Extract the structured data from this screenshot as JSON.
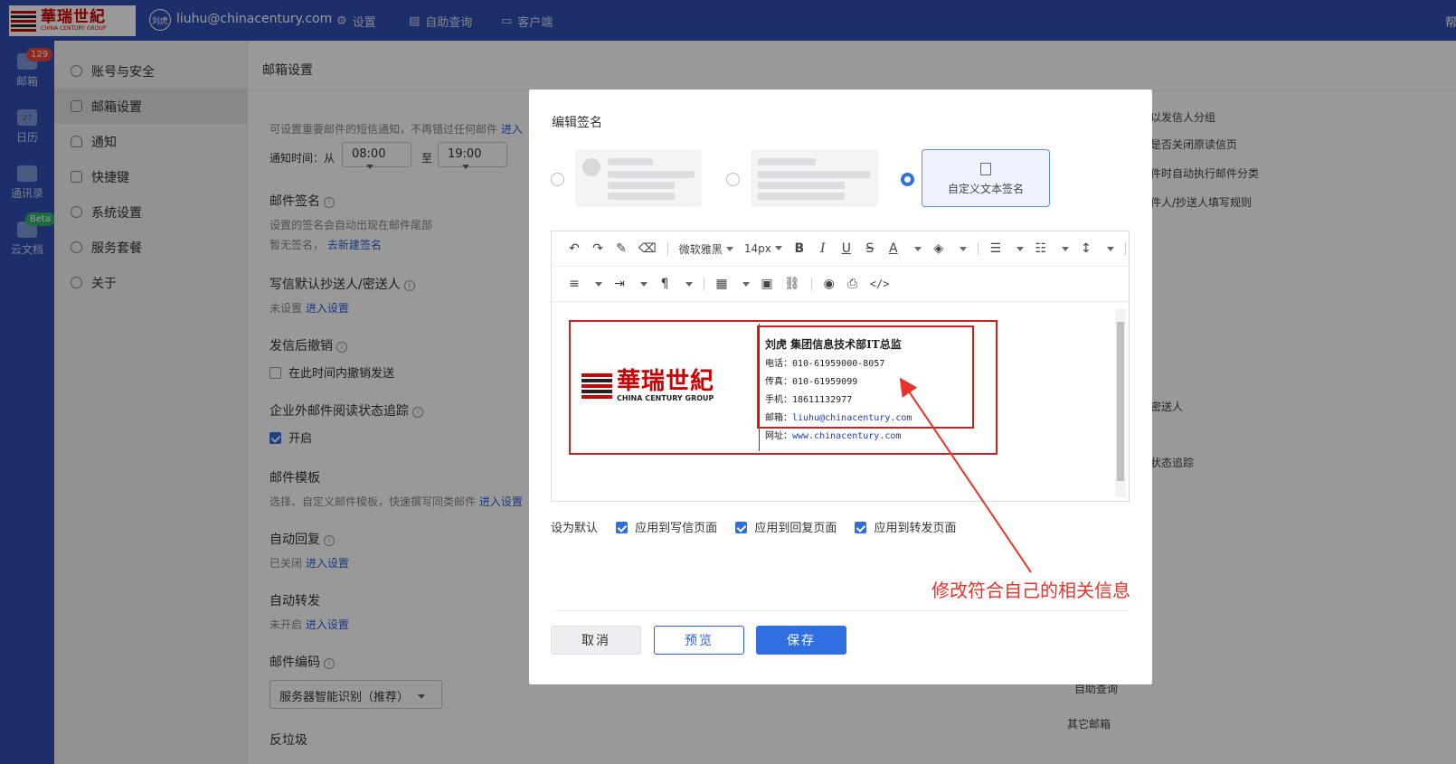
{
  "topbar": {
    "logo_cn": "華瑞世紀",
    "logo_en": "CHINA CENTURY GROUP",
    "avatar": "刘虎",
    "email": "liuhu@chinacentury.com",
    "nav": [
      "设置",
      "自助查询",
      "客户端"
    ],
    "right": "帮"
  },
  "rail": {
    "items": [
      {
        "label": "邮箱",
        "badge": "129"
      },
      {
        "label": "日历",
        "badge": ""
      },
      {
        "label": "通讯录",
        "badge": ""
      },
      {
        "label": "云文档",
        "badge": "Beta"
      }
    ],
    "calendar_day": "27"
  },
  "menu": {
    "items": [
      "账号与安全",
      "邮箱设置",
      "通知",
      "快捷键",
      "系统设置",
      "服务套餐",
      "关于"
    ],
    "active": 1
  },
  "settings": {
    "title": "邮箱设置",
    "sms_note": "可设置重要邮件的短信通知，不再错过任何邮件",
    "sms_link": "进入",
    "notify_time_label": "通知时间：从",
    "from": "08:00",
    "to_label": "至",
    "to": "19:00",
    "signature_title": "邮件签名",
    "signature_desc": "设置的签名会自动出现在邮件尾部",
    "signature_none": "暂无签名，",
    "signature_link": "去新建签名",
    "cc_title": "写信默认抄送人/密送人",
    "cc_status": "未设置",
    "cc_link": "进入设置",
    "undo_title": "发信后撤销",
    "undo_option": "在此时间内撤销发送",
    "tracking_title": "企业外邮件阅读状态追踪",
    "tracking_option": "开启",
    "template_title": "邮件模板",
    "template_desc": "选择、自定义邮件模板，快速撰写同类邮件",
    "template_link": "进入设置",
    "autoreply_title": "自动回复",
    "autoreply_status": "已关闭",
    "autoreply_link": "进入设置",
    "forward_title": "自动转发",
    "forward_status": "未开启",
    "forward_link": "进入设置",
    "encoding_title": "邮件编码",
    "encoding_value": "服务器智能识别（推荐）",
    "spam_title": "反垃圾"
  },
  "right_col": [
    "以发信人分组",
    "是否关闭原读信页",
    "件时自动执行邮件分类",
    "件人/抄送人填写规则",
    "密送人",
    "状态追踪",
    "自助查询",
    "其它邮箱"
  ],
  "modal": {
    "title": "编辑签名",
    "custom_label": "自定义文本签名",
    "toolbar": {
      "font": "微软雅黑",
      "size": "14px"
    },
    "signature": {
      "name_line": "刘虎  集团信息技术部IT总监",
      "phone": "电话：010-61959000-8057",
      "fax": "传真：010-61959099",
      "mobile": "手机：18611132977",
      "mail_label": "邮箱：",
      "mail": "liuhu@chinacentury.com",
      "web_label": "网址：",
      "web": "www.chinacentury.com",
      "logo_cn": "華瑞世紀",
      "logo_en": "CHINA CENTURY GROUP"
    },
    "defaults_label": "设为默认",
    "defaults": [
      "应用到写信页面",
      "应用到回复页面",
      "应用到转发页面"
    ],
    "cancel": "取消",
    "preview": "预览",
    "save": "保存"
  },
  "annotation": "修改符合自己的相关信息",
  "colors": {
    "brand": "#2f4fb2",
    "accent": "#2f6fe0",
    "annotation": "#e8332a"
  }
}
